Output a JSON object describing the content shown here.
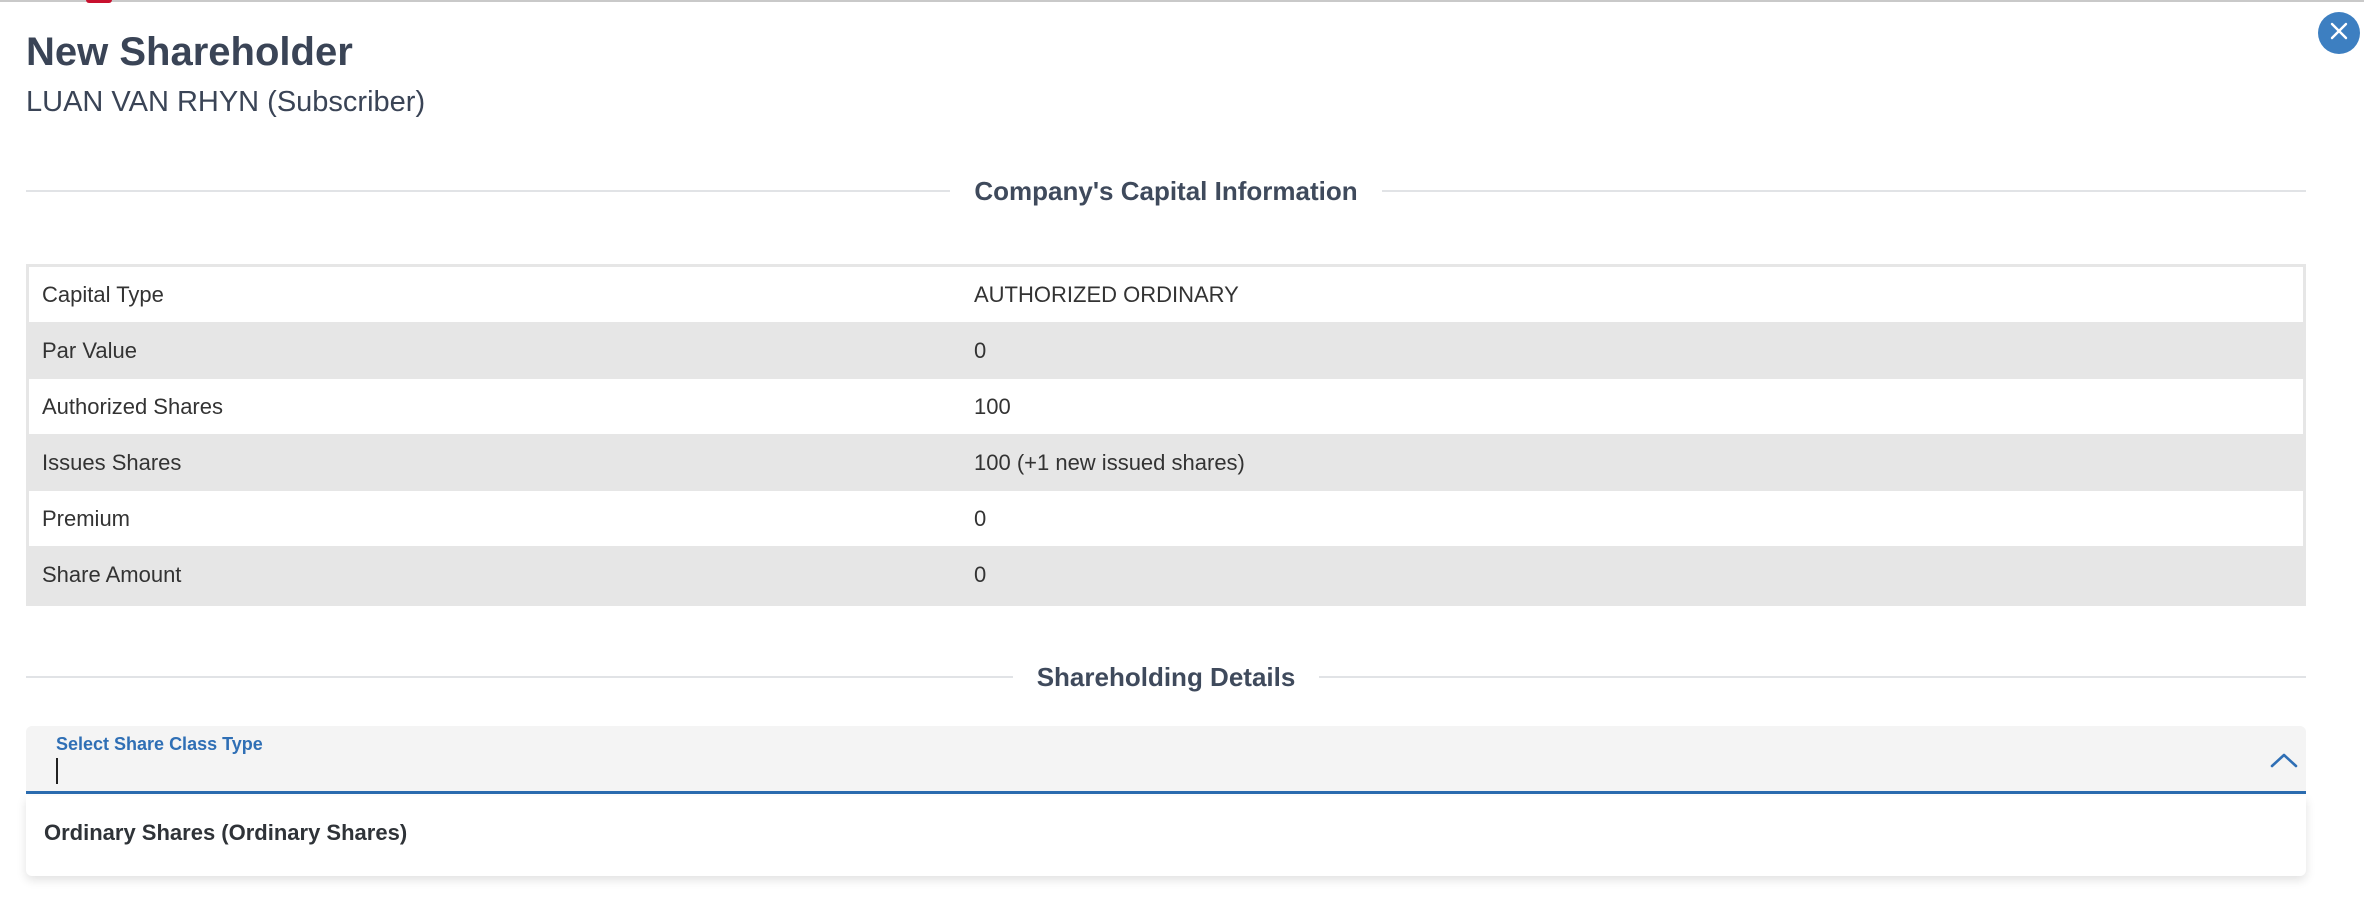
{
  "header": {
    "title": "New Shareholder",
    "subtitle": "LUAN VAN RHYN (Subscriber)"
  },
  "capital_section": {
    "heading": "Company's Capital Information",
    "rows": [
      {
        "label": "Capital Type",
        "value": "AUTHORIZED ORDINARY"
      },
      {
        "label": "Par Value",
        "value": "0"
      },
      {
        "label": "Authorized Shares",
        "value": "100"
      },
      {
        "label": "Issues Shares",
        "value": "100 (+1 new issued shares)"
      },
      {
        "label": "Premium",
        "value": "0"
      },
      {
        "label": "Share Amount",
        "value": "0"
      }
    ]
  },
  "shareholding_section": {
    "heading": "Shareholding Details",
    "share_class_select": {
      "label": "Select Share Class Type",
      "value": "",
      "expanded": true,
      "options": [
        "Ordinary Shares (Ordinary Shares)"
      ]
    }
  },
  "icons": {
    "close": "close-icon",
    "chevron": "chevron-up-icon"
  },
  "colors": {
    "accent_blue": "#3d7fc1",
    "label_blue": "#2f6fb5",
    "heading_text": "#3a4456",
    "row_alt": "#e6e6e6"
  }
}
